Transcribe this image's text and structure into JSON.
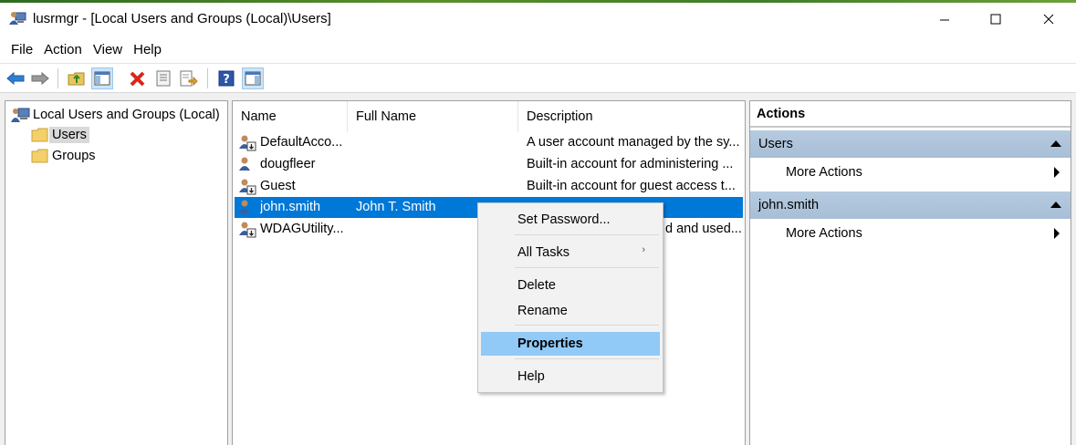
{
  "window": {
    "title": "lusrmgr - [Local Users and Groups (Local)\\Users]",
    "icon": "users-computer-icon"
  },
  "menubar": [
    "File",
    "Action",
    "View",
    "Help"
  ],
  "toolbar": {
    "icons": [
      "back-arrow-icon",
      "forward-arrow-icon",
      "up-folder-icon",
      "show-hide-console-tree-icon",
      "delete-icon",
      "properties-icon",
      "export-list-icon",
      "help-icon",
      "show-hide-action-pane-icon"
    ]
  },
  "tree": {
    "root": "Local Users and Groups (Local)",
    "children": [
      "Users",
      "Groups"
    ],
    "selected": "Users"
  },
  "list": {
    "columns": [
      "Name",
      "Full Name",
      "Description"
    ],
    "rows": [
      {
        "name": "DefaultAcco...",
        "full_name": "",
        "description": "A user account managed by the sy..."
      },
      {
        "name": "dougfleer",
        "full_name": "",
        "description": "Built-in account for administering ..."
      },
      {
        "name": "Guest",
        "full_name": "",
        "description": "Built-in account for guest access t..."
      },
      {
        "name": "john.smith",
        "full_name": "John T. Smith",
        "description": ""
      },
      {
        "name": "WDAGUtility...",
        "full_name": "",
        "description": "d and used..."
      }
    ],
    "selected": "john.smith"
  },
  "actions": {
    "title": "Actions",
    "groups": [
      {
        "label": "Users",
        "items": [
          "More Actions"
        ]
      },
      {
        "label": "john.smith",
        "items": [
          "More Actions"
        ]
      }
    ]
  },
  "context_menu": {
    "items": [
      "Set Password...",
      "All Tasks",
      "Delete",
      "Rename",
      "Properties",
      "Help"
    ],
    "highlighted": "Properties",
    "submenu_glyph": "›"
  },
  "colors": {
    "selection": "#0078d7",
    "menu_highlight": "#91c9f7",
    "action_group": "#a7bed6"
  }
}
